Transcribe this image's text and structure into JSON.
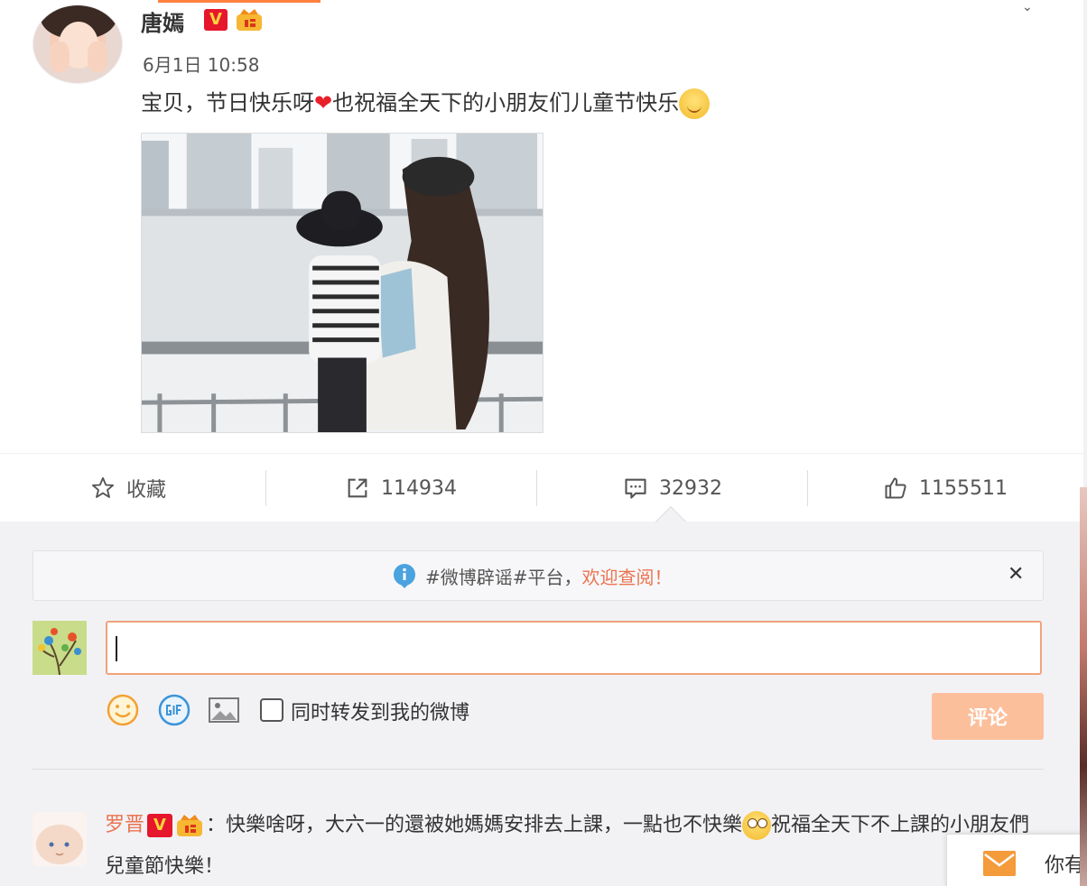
{
  "post": {
    "username": "唐嫣",
    "verified_badge": "V",
    "timestamp": "6月1日 10:58",
    "text_before_heart": "宝贝，节日快乐呀",
    "heart": "❤",
    "text_after_heart": "也祝福全天下的小朋友们儿童节快乐"
  },
  "actions": {
    "favorite_label": "收藏",
    "repost_count": "114934",
    "comment_count": "32932",
    "like_count": "1155511"
  },
  "notice": {
    "text": "#微博辟谣#平台，",
    "link": "欢迎查阅！",
    "close": "✕"
  },
  "composer": {
    "input_value": "",
    "also_repost_label": "同时转发到我的微博",
    "submit_label": "评论"
  },
  "comment": {
    "user": "罗晋",
    "verified_badge": "V",
    "text_part1": "：快樂啥呀，大六一的還被她媽媽安排去上課，一點也不快樂",
    "text_part2": "祝福全天下不上課的小朋友們兒童節快樂！"
  },
  "popup": {
    "text": "你有"
  },
  "colors": {
    "accent": "#eb7350",
    "verified_red": "#e6162d",
    "submit_disabled": "#fcbf9c",
    "background": "#f2f2f5"
  }
}
